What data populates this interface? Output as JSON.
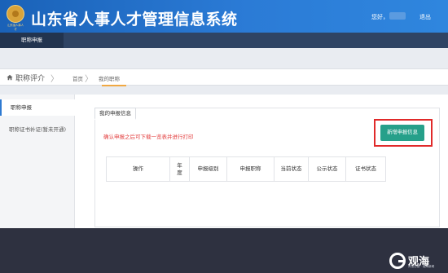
{
  "header": {
    "logo_text": "山东省人事人才",
    "title": "山东省人事人才管理信息系统",
    "greeting": "您好，",
    "logout": "退出"
  },
  "menu": {
    "items": [
      "职称申报"
    ]
  },
  "breadcrumb": {
    "section": "职称评介",
    "home": "首页",
    "current": "我的职称"
  },
  "sidebar": {
    "items": [
      "职称申报",
      "职称证书补证(暂未开通)"
    ]
  },
  "main": {
    "tab": "我的申报信息",
    "notice": "确认申报之后可下载一览表并进行打印",
    "new_button": "新增申报信息",
    "table": {
      "columns": [
        "操作",
        "年度",
        "申报级别",
        "申报职称",
        "当前状态",
        "公示状态",
        "证书状态"
      ]
    }
  },
  "watermark": {
    "text": "观海",
    "subtext": "青岛日报 · 观海新闻"
  }
}
